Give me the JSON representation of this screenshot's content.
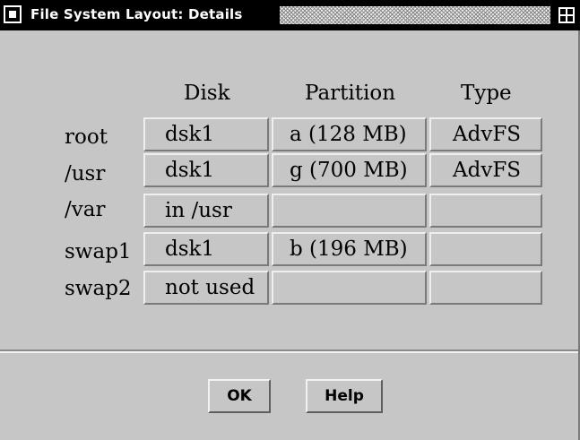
{
  "window": {
    "title": "File System Layout:  Details"
  },
  "table": {
    "headers": {
      "disk": "Disk",
      "partition": "Partition",
      "type": "Type"
    },
    "rows": [
      {
        "label": "root",
        "disk": "dsk1",
        "partition": "a (128 MB)",
        "type": "AdvFS"
      },
      {
        "label": "/usr",
        "disk": "dsk1",
        "partition": "g (700 MB)",
        "type": "AdvFS"
      },
      {
        "label": "/var",
        "disk": "in /usr",
        "partition": "",
        "type": ""
      },
      {
        "label": "swap1",
        "disk": "dsk1",
        "partition": "b (196 MB)",
        "type": ""
      },
      {
        "label": "swap2",
        "disk": "not used",
        "partition": "",
        "type": ""
      }
    ]
  },
  "buttons": {
    "ok": "OK",
    "help": "Help"
  }
}
